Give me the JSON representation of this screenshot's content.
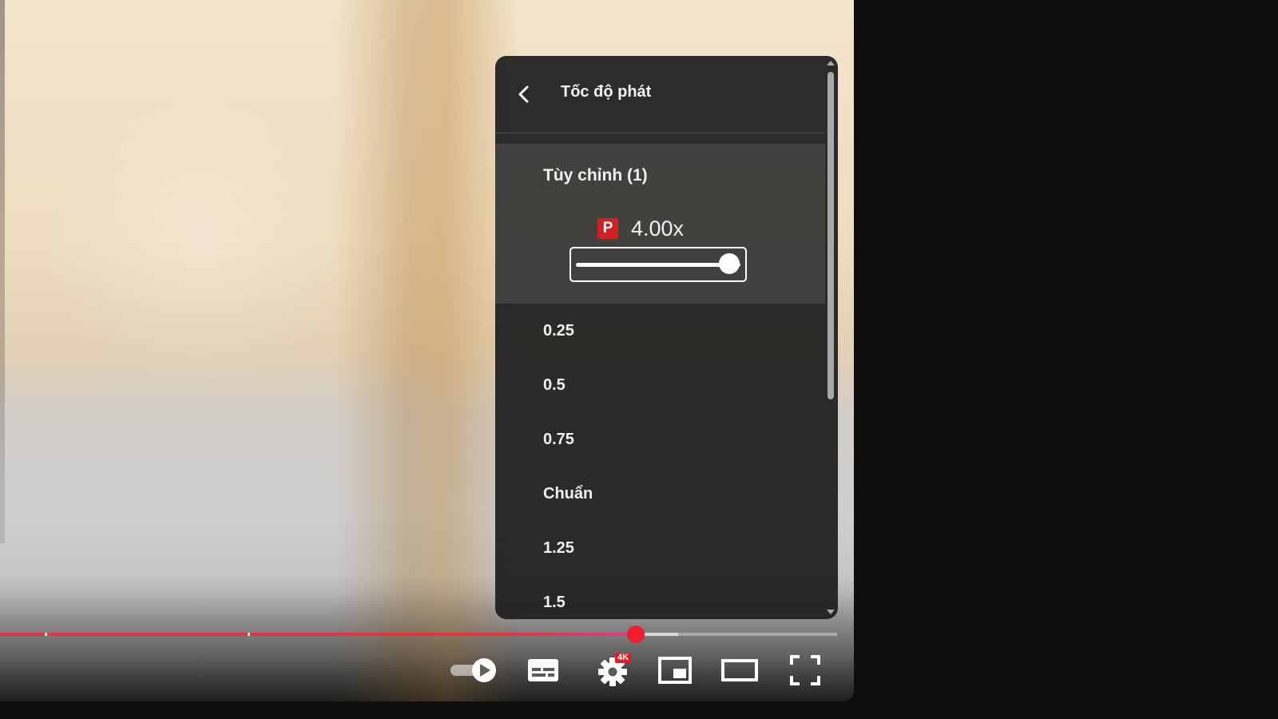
{
  "player": {
    "progress": {
      "played_fraction": 0.76,
      "buffered_fraction": 0.81,
      "colors": {
        "played": "#e8313e",
        "scrubber": "#f21c2f"
      }
    },
    "controls": [
      {
        "name": "autoplay-toggle",
        "icon": "autoplay-toggle-icon"
      },
      {
        "name": "subtitles-button",
        "icon": "subtitles-icon"
      },
      {
        "name": "settings-button",
        "icon": "gear-icon",
        "badge": "4K"
      },
      {
        "name": "miniplayer-button",
        "icon": "miniplayer-icon"
      },
      {
        "name": "theater-mode-button",
        "icon": "theater-mode-icon"
      },
      {
        "name": "fullscreen-button",
        "icon": "fullscreen-icon"
      }
    ]
  },
  "speed_menu": {
    "title": "Tốc độ phát",
    "back_icon": "chevron-left-icon",
    "custom": {
      "label": "Tùy chỉnh (1)",
      "badge": "P",
      "badge_color": "#d11f24",
      "value": "4.00x",
      "slider_fraction": 1.0
    },
    "options": [
      "0.25",
      "0.5",
      "0.75",
      "Chuẩn",
      "1.25",
      "1.5"
    ]
  }
}
